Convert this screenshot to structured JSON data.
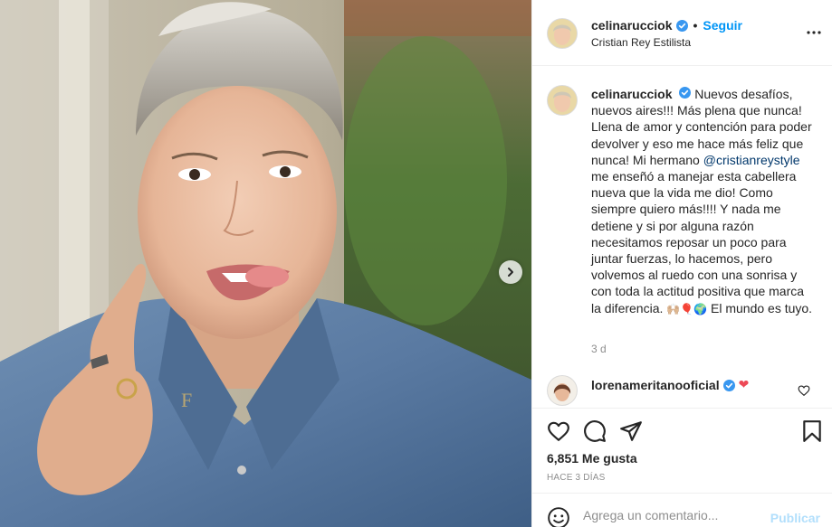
{
  "post": {
    "username": "celinarucciok",
    "verified": true,
    "separator": "•",
    "follow_label": "Seguir",
    "location": "Cristian Rey Estilista",
    "more_icon": "more-options-icon"
  },
  "photo": {
    "next_icon": "chevron-right-icon",
    "ring_text": "F"
  },
  "caption": {
    "username": "celinarucciok",
    "text_before_mention": "Nuevos desafíos, nuevos aires!!! Más plena que nunca! Llena de amor y contención para poder devolver y eso me hace más feliz que nunca! Mi hermano",
    "mention": "@cristianreystyle",
    "text_after_mention": "me enseñó a manejar esta cabellera nueva que la vida me dio! Como siempre quiero más!!!! Y nada me detiene y si por alguna razón necesitamos reposar un poco para juntar fuerzas, lo hacemos, pero volvemos al ruedo con una sonrisa y con toda la actitud positiva que marca la diferencia.",
    "emojis": "🙌🏼🎈🌍",
    "text_end": "El mundo es tuyo.",
    "time": "3 d"
  },
  "comment": {
    "username": "lorenameritanooficial",
    "verified": true,
    "text": "❤"
  },
  "actions": {
    "like_icon": "heart-icon",
    "comment_icon": "comment-icon",
    "share_icon": "share-icon",
    "save_icon": "bookmark-icon",
    "likes": "6,851 Me gusta",
    "time_ago": "HACE 3 DÍAS"
  },
  "add_comment": {
    "placeholder": "Agrega un comentario...",
    "post_label": "Publicar",
    "emoji_icon": "emoji-smile-icon"
  },
  "colors": {
    "link_blue": "#0095f6",
    "mention_blue": "#00376b",
    "secondary_text": "#8e8e8e",
    "publish_disabled": "#b2dffc",
    "heart_red": "#ed4956"
  }
}
